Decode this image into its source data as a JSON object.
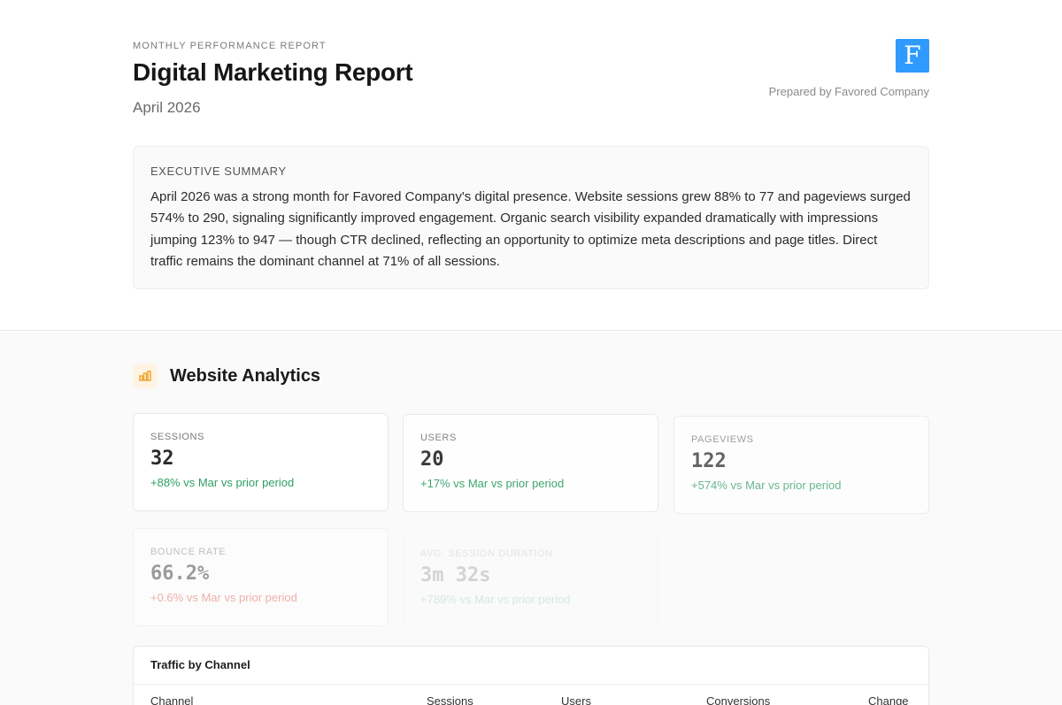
{
  "header": {
    "kicker": "MONTHLY PERFORMANCE REPORT",
    "title": "Digital Marketing Report",
    "subtitle": "April 2026",
    "logo_letter": "F",
    "logo_color": "#2f9bff",
    "prepared_by": "Prepared by Favored Company"
  },
  "summary": {
    "label": "EXECUTIVE SUMMARY",
    "text": "April 2026 was a strong month for Favored Company's digital presence. Website sessions grew 88% to 77 and pageviews surged 574% to 290, signaling significantly improved engagement. Organic search visibility expanded dramatically with impressions jumping 123% to 947 — though CTR declined, reflecting an opportunity to optimize meta descriptions and page titles. Direct traffic remains the dominant channel at 71% of all sessions."
  },
  "analytics": {
    "title": "Website Analytics",
    "icon": "bar-chart-icon",
    "metrics": [
      {
        "label": "SESSIONS",
        "value": "32",
        "change": "+88% vs Mar vs prior period",
        "trend": "positive"
      },
      {
        "label": "USERS",
        "value": "20",
        "change": "+17% vs Mar vs prior period",
        "trend": "positive"
      },
      {
        "label": "PAGEVIEWS",
        "value": "122",
        "change": "+574% vs Mar vs prior period",
        "trend": "positive"
      },
      {
        "label": "BOUNCE RATE",
        "value": "66.2%",
        "change": "+0.6% vs Mar vs prior period",
        "trend": "negative"
      },
      {
        "label": "AVG. SESSION DURATION",
        "value": "3m 32s",
        "change": "+789% vs Mar vs prior period",
        "trend": "positive"
      }
    ]
  },
  "traffic_table": {
    "title": "Traffic by Channel",
    "columns": [
      "Channel",
      "Sessions",
      "Users",
      "Conversions",
      "Change"
    ]
  },
  "colors": {
    "positive": "#2f9e63",
    "negative": "#e0564a",
    "section_icon_bg": "#fff4e3",
    "section_icon_fg": "#f0a020"
  }
}
